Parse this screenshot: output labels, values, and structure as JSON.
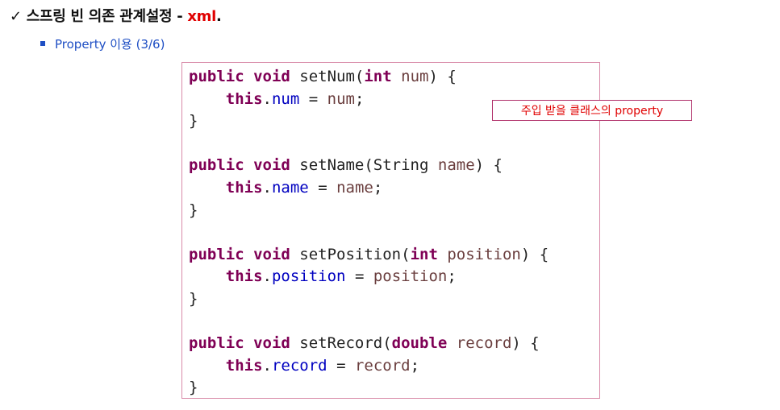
{
  "header": {
    "check_mark": "✓",
    "title": "스프링 빈 의존 관계설정 - ",
    "title_highlight": "xml",
    "title_end": "."
  },
  "subtitle": {
    "text": "Property 이용 (3/6)"
  },
  "callout": {
    "text": "주입 받을 클래스의 property"
  },
  "code": {
    "lines": [
      [
        {
          "t": "public void ",
          "c": "kw"
        },
        {
          "t": "setNum(",
          "c": ""
        },
        {
          "t": "int ",
          "c": "kw"
        },
        {
          "t": "num",
          "c": "param"
        },
        {
          "t": ") {",
          "c": ""
        }
      ],
      [
        {
          "t": "    ",
          "c": ""
        },
        {
          "t": "this",
          "c": "kw"
        },
        {
          "t": ".",
          "c": ""
        },
        {
          "t": "num",
          "c": "fld"
        },
        {
          "t": " = ",
          "c": ""
        },
        {
          "t": "num",
          "c": "param"
        },
        {
          "t": ";",
          "c": ""
        }
      ],
      [
        {
          "t": "}",
          "c": ""
        }
      ],
      [],
      [
        {
          "t": "public void ",
          "c": "kw"
        },
        {
          "t": "setName(String ",
          "c": ""
        },
        {
          "t": "name",
          "c": "param"
        },
        {
          "t": ") {",
          "c": ""
        }
      ],
      [
        {
          "t": "    ",
          "c": ""
        },
        {
          "t": "this",
          "c": "kw"
        },
        {
          "t": ".",
          "c": ""
        },
        {
          "t": "name",
          "c": "fld"
        },
        {
          "t": " = ",
          "c": ""
        },
        {
          "t": "name",
          "c": "param"
        },
        {
          "t": ";",
          "c": ""
        }
      ],
      [
        {
          "t": "}",
          "c": ""
        }
      ],
      [],
      [
        {
          "t": "public void ",
          "c": "kw"
        },
        {
          "t": "setPosition(",
          "c": ""
        },
        {
          "t": "int ",
          "c": "kw"
        },
        {
          "t": "position",
          "c": "param"
        },
        {
          "t": ") {",
          "c": ""
        }
      ],
      [
        {
          "t": "    ",
          "c": ""
        },
        {
          "t": "this",
          "c": "kw"
        },
        {
          "t": ".",
          "c": ""
        },
        {
          "t": "position",
          "c": "fld"
        },
        {
          "t": " = ",
          "c": ""
        },
        {
          "t": "position",
          "c": "param"
        },
        {
          "t": ";",
          "c": ""
        }
      ],
      [
        {
          "t": "}",
          "c": ""
        }
      ],
      [],
      [
        {
          "t": "public void ",
          "c": "kw"
        },
        {
          "t": "setRecord(",
          "c": ""
        },
        {
          "t": "double ",
          "c": "kw"
        },
        {
          "t": "record",
          "c": "param"
        },
        {
          "t": ") {",
          "c": ""
        }
      ],
      [
        {
          "t": "    ",
          "c": ""
        },
        {
          "t": "this",
          "c": "kw"
        },
        {
          "t": ".",
          "c": ""
        },
        {
          "t": "record",
          "c": "fld"
        },
        {
          "t": " = ",
          "c": ""
        },
        {
          "t": "record",
          "c": "param"
        },
        {
          "t": ";",
          "c": ""
        }
      ],
      [
        {
          "t": "}",
          "c": ""
        }
      ]
    ]
  },
  "colors": {
    "keyword": "#7f0055",
    "field": "#0000c0",
    "highlight": "#e00000",
    "subtitle": "#1f4fc4",
    "box_border": "#d98aa8"
  }
}
